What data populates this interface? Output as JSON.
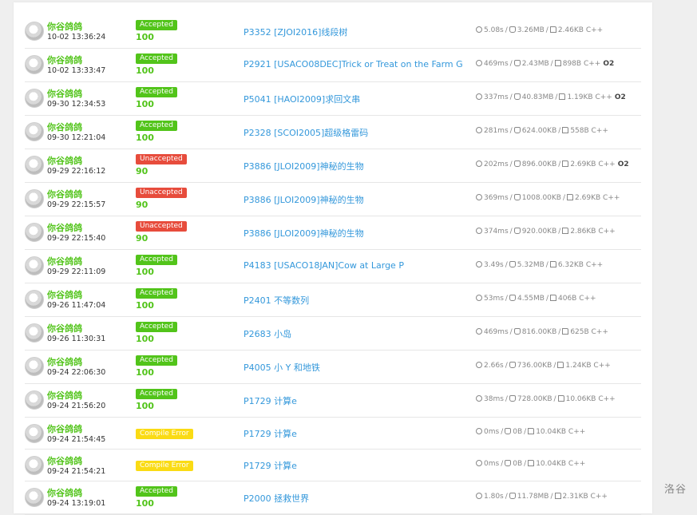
{
  "watermark": "洛谷",
  "records": [
    {
      "user": "你谷鸽鸽",
      "time": "10-02 13:36:24",
      "status": "Accepted",
      "status_type": "ac",
      "score": "100",
      "problem": "P3352 [ZJOI2016]线段树",
      "time_used": "5.08s",
      "memory": "3.26MB",
      "code_size": "2.46KB",
      "lang": "C++",
      "o2": ""
    },
    {
      "user": "你谷鸽鸽",
      "time": "10-02 13:33:47",
      "status": "Accepted",
      "status_type": "ac",
      "score": "100",
      "problem": "P2921 [USACO08DEC]Trick or Treat on the Farm G",
      "time_used": "469ms",
      "memory": "2.43MB",
      "code_size": "898B",
      "lang": "C++",
      "o2": "O2"
    },
    {
      "user": "你谷鸽鸽",
      "time": "09-30 12:34:53",
      "status": "Accepted",
      "status_type": "ac",
      "score": "100",
      "problem": "P5041 [HAOI2009]求回文串",
      "time_used": "337ms",
      "memory": "40.83MB",
      "code_size": "1.19KB",
      "lang": "C++",
      "o2": "O2"
    },
    {
      "user": "你谷鸽鸽",
      "time": "09-30 12:21:04",
      "status": "Accepted",
      "status_type": "ac",
      "score": "100",
      "problem": "P2328 [SCOI2005]超级格雷码",
      "time_used": "281ms",
      "memory": "624.00KB",
      "code_size": "558B",
      "lang": "C++",
      "o2": ""
    },
    {
      "user": "你谷鸽鸽",
      "time": "09-29 22:16:12",
      "status": "Unaccepted",
      "status_type": "un",
      "score": "90",
      "problem": "P3886 [JLOI2009]神秘的生物",
      "time_used": "202ms",
      "memory": "896.00KB",
      "code_size": "2.69KB",
      "lang": "C++",
      "o2": "O2"
    },
    {
      "user": "你谷鸽鸽",
      "time": "09-29 22:15:57",
      "status": "Unaccepted",
      "status_type": "un",
      "score": "90",
      "problem": "P3886 [JLOI2009]神秘的生物",
      "time_used": "369ms",
      "memory": "1008.00KB",
      "code_size": "2.69KB",
      "lang": "C++",
      "o2": ""
    },
    {
      "user": "你谷鸽鸽",
      "time": "09-29 22:15:40",
      "status": "Unaccepted",
      "status_type": "un",
      "score": "90",
      "problem": "P3886 [JLOI2009]神秘的生物",
      "time_used": "374ms",
      "memory": "920.00KB",
      "code_size": "2.86KB",
      "lang": "C++",
      "o2": ""
    },
    {
      "user": "你谷鸽鸽",
      "time": "09-29 22:11:09",
      "status": "Accepted",
      "status_type": "ac",
      "score": "100",
      "problem": "P4183 [USACO18JAN]Cow at Large P",
      "time_used": "3.49s",
      "memory": "5.32MB",
      "code_size": "6.32KB",
      "lang": "C++",
      "o2": ""
    },
    {
      "user": "你谷鸽鸽",
      "time": "09-26 11:47:04",
      "status": "Accepted",
      "status_type": "ac",
      "score": "100",
      "problem": "P2401 不等数列",
      "time_used": "53ms",
      "memory": "4.55MB",
      "code_size": "406B",
      "lang": "C++",
      "o2": ""
    },
    {
      "user": "你谷鸽鸽",
      "time": "09-26 11:30:31",
      "status": "Accepted",
      "status_type": "ac",
      "score": "100",
      "problem": "P2683 小岛",
      "time_used": "469ms",
      "memory": "816.00KB",
      "code_size": "625B",
      "lang": "C++",
      "o2": ""
    },
    {
      "user": "你谷鸽鸽",
      "time": "09-24 22:06:30",
      "status": "Accepted",
      "status_type": "ac",
      "score": "100",
      "problem": "P4005 小 Y 和地铁",
      "time_used": "2.66s",
      "memory": "736.00KB",
      "code_size": "1.24KB",
      "lang": "C++",
      "o2": ""
    },
    {
      "user": "你谷鸽鸽",
      "time": "09-24 21:56:20",
      "status": "Accepted",
      "status_type": "ac",
      "score": "100",
      "problem": "P1729 计算e",
      "time_used": "38ms",
      "memory": "728.00KB",
      "code_size": "10.06KB",
      "lang": "C++",
      "o2": ""
    },
    {
      "user": "你谷鸽鸽",
      "time": "09-24 21:54:45",
      "status": "Compile Error",
      "status_type": "ce",
      "score": "",
      "problem": "P1729 计算e",
      "time_used": "0ms",
      "memory": "0B",
      "code_size": "10.04KB",
      "lang": "C++",
      "o2": ""
    },
    {
      "user": "你谷鸽鸽",
      "time": "09-24 21:54:21",
      "status": "Compile Error",
      "status_type": "ce",
      "score": "",
      "problem": "P1729 计算e",
      "time_used": "0ms",
      "memory": "0B",
      "code_size": "10.04KB",
      "lang": "C++",
      "o2": ""
    },
    {
      "user": "你谷鸽鸽",
      "time": "09-24 13:19:01",
      "status": "Accepted",
      "status_type": "ac",
      "score": "100",
      "problem": "P2000 拯救世界",
      "time_used": "1.80s",
      "memory": "11.78MB",
      "code_size": "2.31KB",
      "lang": "C++",
      "o2": ""
    }
  ]
}
